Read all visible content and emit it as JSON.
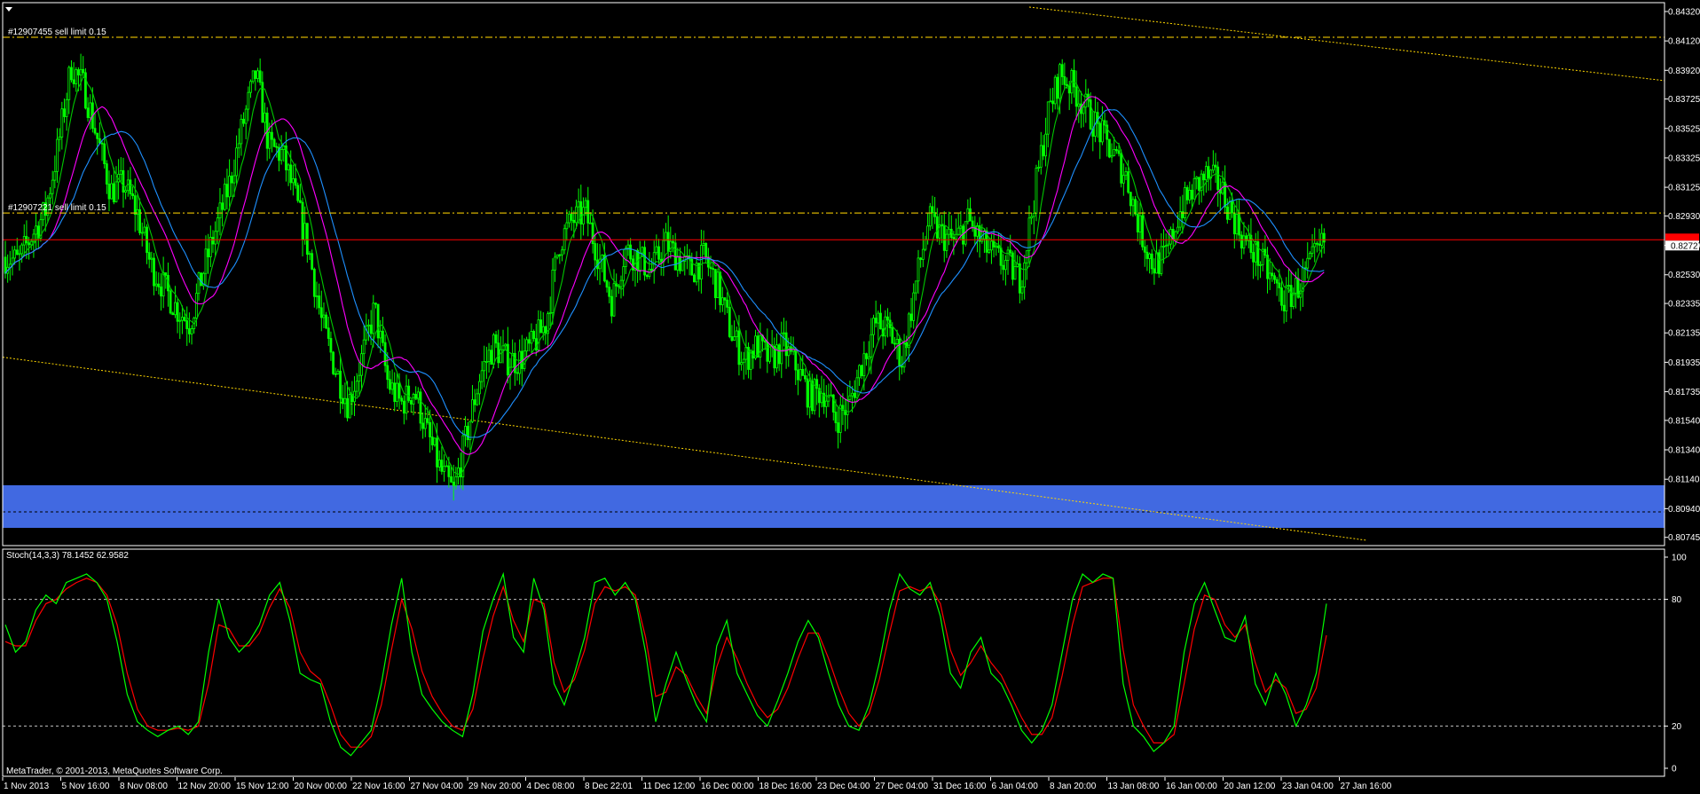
{
  "colors": {
    "background": "#000000",
    "frame": "#ffffff",
    "candle": "#00ff00",
    "ma_fast": "#00c800",
    "ma_mid": "#ff00ff",
    "ma_slow": "#1e90ff",
    "bid_line": "#ff0000",
    "bid_badge": "#ff0000",
    "order_line": "#d4b000",
    "trendline": "#ffd700",
    "zone": "#4169e1",
    "stoch_main": "#00ff00",
    "stoch_signal": "#ff0000",
    "stoch_level": "#c0c0c0"
  },
  "icons": {
    "menu": "triangle-down-icon"
  },
  "orders": [
    {
      "label": "#12907455 sell limit 0.15",
      "price": 0.84145
    },
    {
      "label": "#12907221 sell limit 0.15",
      "price": 0.8295
    }
  ],
  "bid": {
    "price": 0.82768,
    "label": "0.82727"
  },
  "price_axis": {
    "labels": [
      "0.84320",
      "0.84120",
      "0.83920",
      "0.83725",
      "0.83525",
      "0.83325",
      "0.83125",
      "0.82930",
      "0.82730",
      "0.82530",
      "0.82335",
      "0.82135",
      "0.81935",
      "0.81735",
      "0.81540",
      "0.81340",
      "0.81140",
      "0.80940",
      "0.80745"
    ],
    "max": 0.8435,
    "min": 0.80725
  },
  "stoch": {
    "label": "Stoch(14,3,3) 78.1452 62.9582",
    "levels": [
      "100",
      "80",
      "20",
      "0"
    ],
    "main": [
      68,
      55,
      60,
      75,
      82,
      78,
      88,
      90,
      92,
      88,
      80,
      60,
      35,
      22,
      18,
      15,
      18,
      20,
      16,
      22,
      55,
      80,
      62,
      55,
      60,
      68,
      82,
      88,
      70,
      45,
      42,
      40,
      22,
      10,
      6,
      12,
      18,
      40,
      68,
      90,
      55,
      35,
      28,
      22,
      18,
      15,
      35,
      65,
      80,
      92,
      62,
      55,
      90,
      75,
      40,
      30,
      45,
      62,
      88,
      90,
      82,
      88,
      80,
      55,
      22,
      40,
      55,
      42,
      30,
      22,
      58,
      70,
      45,
      35,
      25,
      20,
      32,
      45,
      60,
      70,
      62,
      45,
      30,
      20,
      18,
      30,
      50,
      75,
      92,
      85,
      82,
      88,
      72,
      45,
      38,
      55,
      62,
      45,
      40,
      30,
      18,
      12,
      18,
      30,
      55,
      80,
      92,
      88,
      92,
      90,
      40,
      20,
      15,
      8,
      12,
      20,
      55,
      78,
      88,
      75,
      62,
      60,
      72,
      40,
      30,
      45,
      35,
      20,
      30,
      45,
      78
    ],
    "signal": [
      60,
      58,
      58,
      70,
      78,
      80,
      85,
      88,
      90,
      88,
      82,
      68,
      45,
      28,
      20,
      18,
      18,
      19,
      18,
      20,
      40,
      68,
      66,
      58,
      58,
      64,
      76,
      85,
      76,
      55,
      46,
      42,
      30,
      16,
      10,
      10,
      15,
      30,
      56,
      80,
      66,
      46,
      34,
      26,
      20,
      18,
      28,
      52,
      72,
      86,
      70,
      60,
      80,
      78,
      50,
      36,
      42,
      56,
      78,
      86,
      84,
      86,
      82,
      62,
      34,
      36,
      48,
      44,
      34,
      26,
      48,
      62,
      52,
      40,
      30,
      24,
      28,
      38,
      52,
      64,
      64,
      52,
      38,
      26,
      20,
      26,
      42,
      64,
      84,
      86,
      84,
      86,
      78,
      56,
      44,
      50,
      58,
      50,
      44,
      34,
      24,
      16,
      16,
      24,
      44,
      68,
      86,
      88,
      90,
      90,
      56,
      30,
      20,
      12,
      12,
      16,
      40,
      66,
      82,
      80,
      68,
      62,
      68,
      50,
      36,
      42,
      38,
      26,
      28,
      38,
      63
    ]
  },
  "time_axis": {
    "labels": [
      "1 Nov 2013",
      "5 Nov 16:00",
      "8 Nov 08:00",
      "12 Nov 20:00",
      "15 Nov 12:00",
      "20 Nov 00:00",
      "22 Nov 16:00",
      "27 Nov 04:00",
      "29 Nov 20:00",
      "4 Dec 08:00",
      "8 Dec 22:01",
      "11 Dec 12:00",
      "16 Dec 00:00",
      "18 Dec 16:00",
      "23 Dec 04:00",
      "27 Dec 04:00",
      "31 Dec 16:00",
      "6 Jan 04:00",
      "8 Jan 20:00",
      "13 Jan 08:00",
      "16 Jan 00:00",
      "20 Jan 12:00",
      "23 Jan 04:00",
      "27 Jan 16:00"
    ]
  },
  "copyright": "MetaTrader, © 2001-2013, MetaQuotes Software Corp.",
  "closes": [
    0.8265,
    0.8262,
    0.828,
    0.8295,
    0.834,
    0.8395,
    0.838,
    0.8345,
    0.831,
    0.8315,
    0.8295,
    0.826,
    0.8245,
    0.823,
    0.822,
    0.8255,
    0.8285,
    0.8315,
    0.8355,
    0.839,
    0.834,
    0.8335,
    0.8305,
    0.827,
    0.822,
    0.819,
    0.8165,
    0.8195,
    0.823,
    0.818,
    0.8165,
    0.8175,
    0.8145,
    0.812,
    0.8105,
    0.8145,
    0.8185,
    0.8205,
    0.8195,
    0.8195,
    0.8205,
    0.822,
    0.8275,
    0.829,
    0.8295,
    0.8265,
    0.8235,
    0.827,
    0.8265,
    0.8255,
    0.8275,
    0.8265,
    0.8255,
    0.8265,
    0.8245,
    0.8215,
    0.8195,
    0.8205,
    0.8195,
    0.8205,
    0.819,
    0.817,
    0.8175,
    0.8155,
    0.8165,
    0.8195,
    0.822,
    0.8215,
    0.8195,
    0.8245,
    0.829,
    0.828,
    0.8275,
    0.829,
    0.8275,
    0.8265,
    0.826,
    0.825,
    0.8305,
    0.836,
    0.839,
    0.838,
    0.8365,
    0.835,
    0.8335,
    0.832,
    0.8285,
    0.826,
    0.8265,
    0.8295,
    0.831,
    0.832,
    0.8315,
    0.8295,
    0.8275,
    0.8265,
    0.825,
    0.8235,
    0.8245,
    0.826,
    0.8275
  ]
}
